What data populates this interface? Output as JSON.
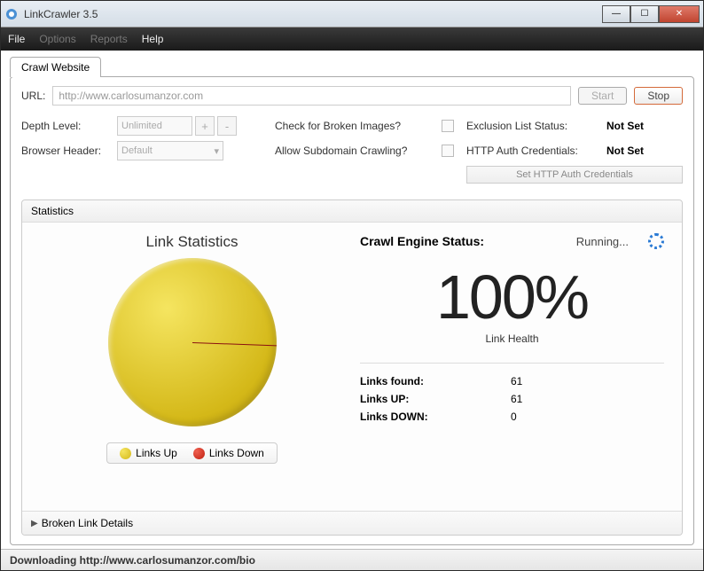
{
  "window": {
    "title": "LinkCrawler 3.5"
  },
  "menu": {
    "file": "File",
    "options": "Options",
    "reports": "Reports",
    "help": "Help"
  },
  "tab": {
    "label": "Crawl Website"
  },
  "url": {
    "label": "URL:",
    "value": "http://www.carlosumanzor.com",
    "start": "Start",
    "stop": "Stop"
  },
  "config": {
    "depth_label": "Depth Level:",
    "depth_value": "Unlimited",
    "browser_label": "Browser Header:",
    "browser_value": "Default",
    "broken_img_label": "Check for Broken Images?",
    "subdomain_label": "Allow Subdomain Crawling?",
    "exclusion_label": "Exclusion List Status:",
    "exclusion_value": "Not Set",
    "auth_label": "HTTP Auth Credentials:",
    "auth_value": "Not Set",
    "auth_button": "Set HTTP Auth Credentials"
  },
  "stats": {
    "header": "Statistics",
    "chart_title": "Link Statistics",
    "legend_up": "Links Up",
    "legend_down": "Links Down",
    "engine_label": "Crawl Engine Status:",
    "engine_status": "Running...",
    "percent": "100%",
    "health_label": "Link Health",
    "found_label": "Links found:",
    "found_value": "61",
    "up_label": "Links UP:",
    "up_value": "61",
    "down_label": "Links DOWN:",
    "down_value": "0",
    "broken_label": "Broken Link Details"
  },
  "chart_data": {
    "type": "pie",
    "title": "Link Statistics",
    "series": [
      {
        "name": "Links Up",
        "value": 61,
        "color": "#d4b818"
      },
      {
        "name": "Links Down",
        "value": 0,
        "color": "#c02010"
      }
    ]
  },
  "statusbar": {
    "text": "Downloading http://www.carlosumanzor.com/bio"
  }
}
